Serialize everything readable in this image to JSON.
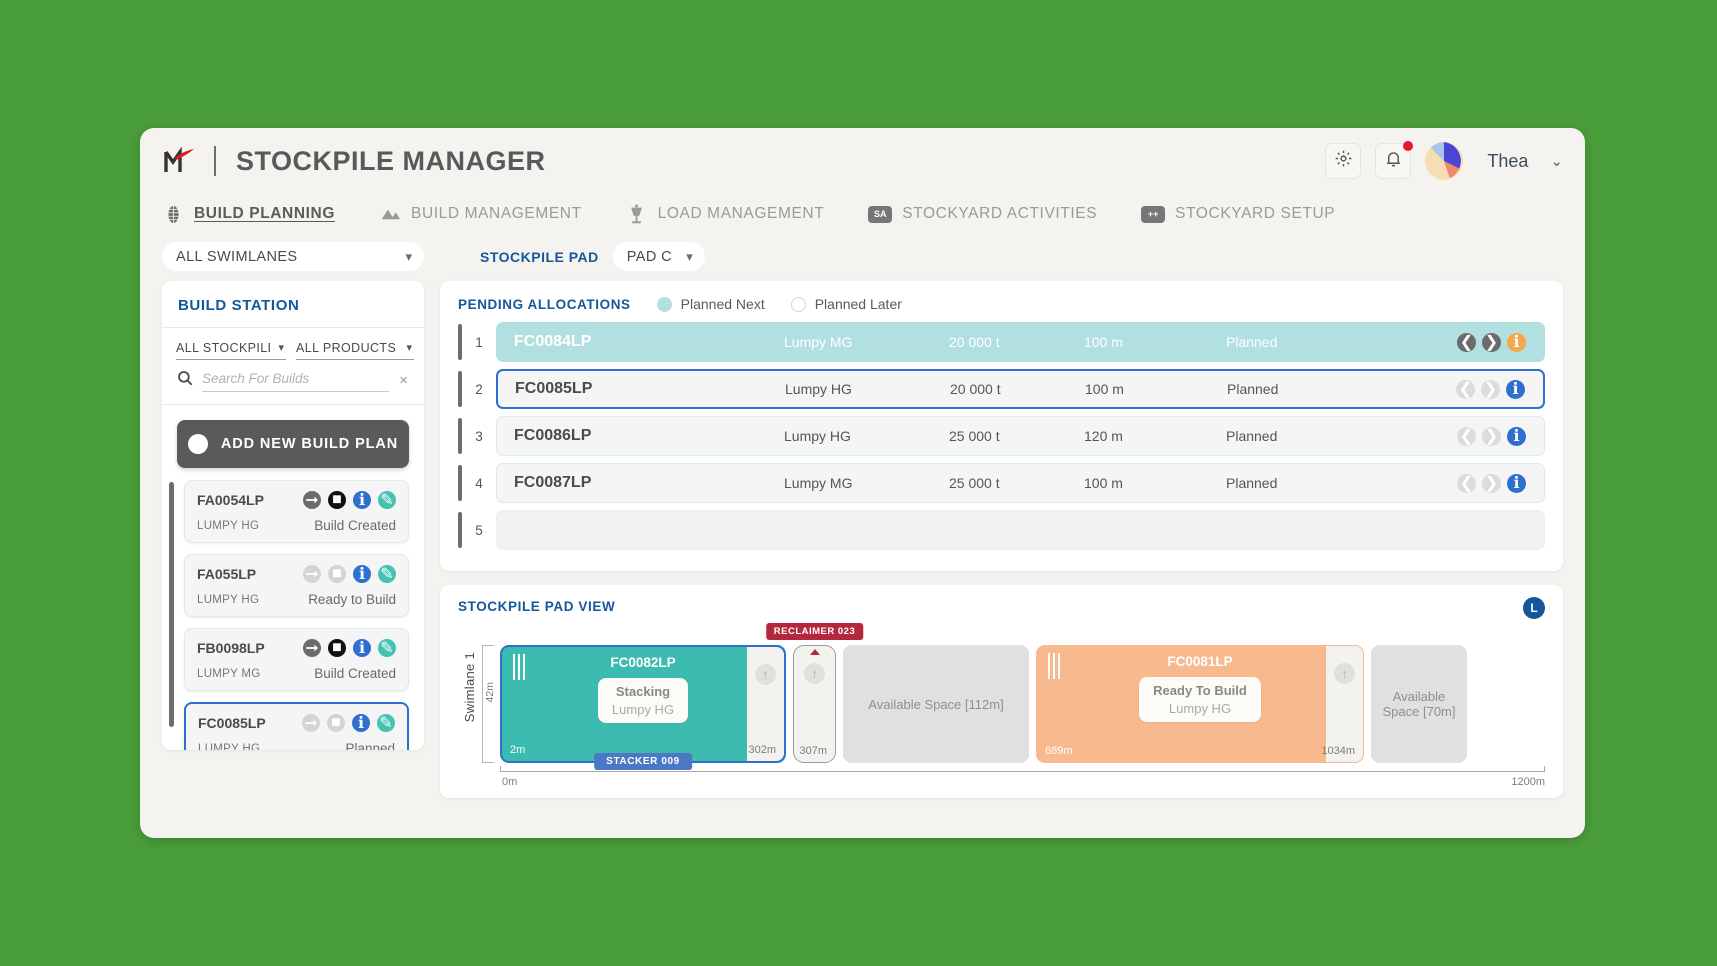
{
  "header": {
    "app_title": "STOCKPILE MANAGER",
    "settings_icon": "gear-icon",
    "notifications_icon": "bell-icon",
    "user_name": "Thea",
    "user_chevron": "⌄"
  },
  "nav": {
    "items": [
      {
        "label": "BUILD PLANNING",
        "icon": "stockpile-icon",
        "active": true
      },
      {
        "label": "BUILD MANAGEMENT",
        "icon": "mountain-icon",
        "active": false
      },
      {
        "label": "LOAD MANAGEMENT",
        "icon": "loader-icon",
        "active": false
      },
      {
        "label": "STOCKYARD ACTIVITIES",
        "icon": "sa-chip-icon",
        "chip": "SA",
        "active": false
      },
      {
        "label": "STOCKYARD SETUP",
        "icon": "plus-chip-icon",
        "chip": "++",
        "active": false
      }
    ]
  },
  "filters": {
    "swimlane_value": "ALL SWIMLANES",
    "stockpile_pad_label": "STOCKPILE PAD",
    "stockpile_pad_value": "PAD C"
  },
  "build_station": {
    "title": "BUILD STATION",
    "pad_filter_value": "ALL STOCKPILE PAD",
    "product_filter_value": "ALL PRODUCTS",
    "search_placeholder": "Search For Builds",
    "search_value": "",
    "clear_icon": "×",
    "add_button_label": "ADD NEW BUILD PLAN",
    "cards": [
      {
        "id": "FA0054LP",
        "product": "LUMPY HG",
        "status": "Build Created",
        "icons": {
          "forward": "active",
          "stop": "active",
          "info": "active",
          "edit": "active"
        }
      },
      {
        "id": "FA055LP",
        "product": "LUMPY HG",
        "status": "Ready to Build",
        "icons": {
          "forward": "dim",
          "stop": "dim",
          "info": "active",
          "edit": "active"
        }
      },
      {
        "id": "FB0098LP",
        "product": "LUMPY MG",
        "status": "Build Created",
        "icons": {
          "forward": "active",
          "stop": "active",
          "info": "active",
          "edit": "active"
        }
      },
      {
        "id": "FC0085LP",
        "product": "LUMPY HG",
        "status": "Planned",
        "selected": true,
        "icons": {
          "forward": "dim",
          "stop": "dim",
          "info": "active",
          "edit": "active"
        }
      }
    ]
  },
  "pending_allocations": {
    "title": "PENDING ALLOCATIONS",
    "legend": [
      {
        "label": "Planned Next",
        "style": "filled"
      },
      {
        "label": "Planned Later",
        "style": "hollow"
      }
    ],
    "rows": [
      {
        "num": "1",
        "id": "FC0084LP",
        "product": "Lumpy MG",
        "tonnes": "20 000 t",
        "length": "100 m",
        "status": "Planned",
        "highlight": "planned-next",
        "actions": {
          "back": "active",
          "down": "active",
          "info": "warn"
        }
      },
      {
        "num": "2",
        "id": "FC0085LP",
        "product": "Lumpy HG",
        "tonnes": "20 000 t",
        "length": "100 m",
        "status": "Planned",
        "highlight": "selected",
        "actions": {
          "back": "dim",
          "down": "dim",
          "info": "active"
        }
      },
      {
        "num": "3",
        "id": "FC0086LP",
        "product": "Lumpy HG",
        "tonnes": "25 000 t",
        "length": "120 m",
        "status": "Planned",
        "highlight": "normal",
        "actions": {
          "back": "dim",
          "down": "dim",
          "info": "active"
        }
      },
      {
        "num": "4",
        "id": "FC0087LP",
        "product": "Lumpy MG",
        "tonnes": "25 000 t",
        "length": "100 m",
        "status": "Planned",
        "highlight": "normal",
        "actions": {
          "back": "dim",
          "down": "dim",
          "info": "active"
        }
      },
      {
        "num": "5",
        "id": "",
        "product": "",
        "tonnes": "",
        "length": "",
        "status": "",
        "highlight": "empty",
        "actions": null
      }
    ]
  },
  "pad_view": {
    "title": "STOCKPILE PAD VIEW",
    "badge": "L",
    "swimlane_label": "Swimlane 1",
    "height_label": "42m",
    "reclaimer_tag": "RECLAIMER 023",
    "stacker_tag": "STACKER 009",
    "axis_start": "0m",
    "axis_end": "1200m",
    "piles": [
      {
        "kind": "pile",
        "color": "teal",
        "name": "FC0082LP",
        "state": "Stacking",
        "product": "Lumpy HG",
        "start_m": "2m",
        "end_m": "302m",
        "selected": true
      },
      {
        "kind": "gap",
        "end_m": "307m",
        "reclaimer": true
      },
      {
        "kind": "space",
        "label": "Available Space [112m]"
      },
      {
        "kind": "pile",
        "color": "orange",
        "name": "FC0081LP",
        "state": "Ready To Build",
        "product": "Lumpy HG",
        "start_m": "689m",
        "end_m": "1034m",
        "selected": false
      },
      {
        "kind": "space",
        "label": "Available Space [70m]"
      }
    ]
  },
  "colors": {
    "brand_blue": "#14579b",
    "accent_teal": "#3cbcb0",
    "accent_orange": "#f8b98e",
    "planned_next": "#b2e0e0",
    "select_blue": "#2f6fd0",
    "reclaimer_red": "#b3283c",
    "stacker_blue": "#4a78c4",
    "page_green": "#4a9e3a"
  }
}
